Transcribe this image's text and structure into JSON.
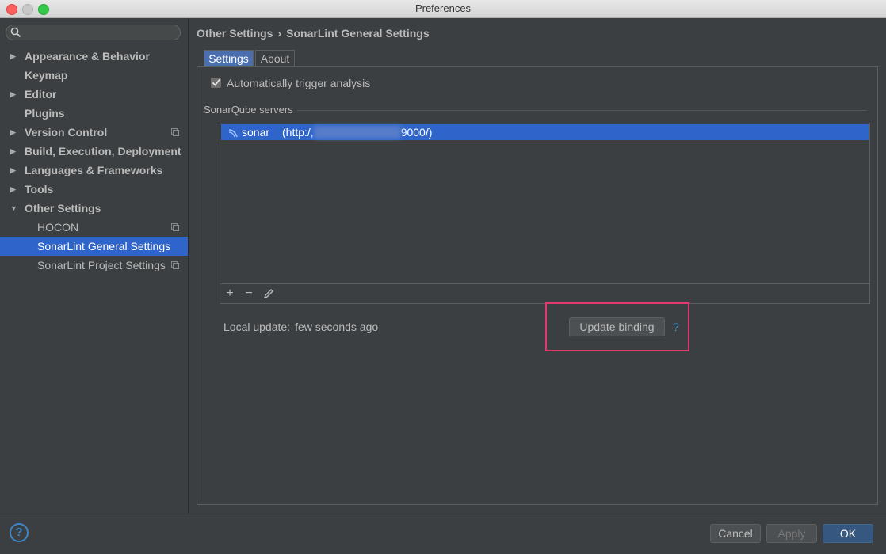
{
  "window": {
    "title": "Preferences"
  },
  "sidebar": {
    "search_placeholder": "",
    "items": [
      {
        "label": "Appearance & Behavior",
        "expandable": true
      },
      {
        "label": "Keymap",
        "expandable": false
      },
      {
        "label": "Editor",
        "expandable": true
      },
      {
        "label": "Plugins",
        "expandable": false
      },
      {
        "label": "Version Control",
        "expandable": true,
        "project_icon": true
      },
      {
        "label": "Build, Execution, Deployment",
        "expandable": true
      },
      {
        "label": "Languages & Frameworks",
        "expandable": true
      },
      {
        "label": "Tools",
        "expandable": true
      },
      {
        "label": "Other Settings",
        "expandable": true,
        "expanded": true
      },
      {
        "label": "HOCON",
        "child": true,
        "project_icon": true
      },
      {
        "label": "SonarLint General Settings",
        "child": true,
        "selected": true
      },
      {
        "label": "SonarLint Project Settings",
        "child": true,
        "project_icon": true
      }
    ]
  },
  "breadcrumb": {
    "parent": "Other Settings",
    "separator": "›",
    "current": "SonarLint General Settings"
  },
  "tabs": [
    {
      "label": "Settings",
      "active": true
    },
    {
      "label": "About",
      "active": false
    }
  ],
  "settings": {
    "auto_trigger_label": "Automatically trigger analysis",
    "auto_trigger_checked": true,
    "servers_group_title": "SonarQube servers",
    "servers": [
      {
        "name": "sonar",
        "url": "(http:/,",
        "url_tail": "9000/)"
      }
    ],
    "local_update_label": "Local update:",
    "local_update_value": "few seconds ago",
    "update_binding_label": "Update binding",
    "help_link": "?"
  },
  "toolbar": {
    "add": "+",
    "remove": "−"
  },
  "footer": {
    "help": "?",
    "cancel": "Cancel",
    "apply": "Apply",
    "ok": "OK"
  },
  "colors": {
    "selection": "#2f65ca",
    "highlight_box": "#e2386e",
    "primary_button": "#365880"
  }
}
